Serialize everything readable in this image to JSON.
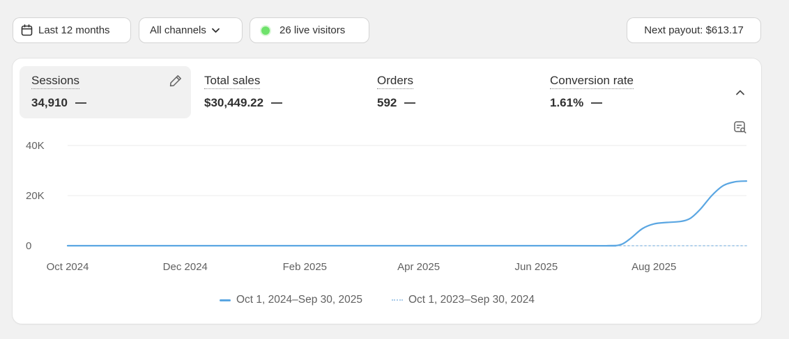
{
  "filters": {
    "date_range_label": "Last 12 months",
    "channels_label": "All channels",
    "live_visitors_label": "26 live visitors"
  },
  "payout": {
    "label": "Next payout: $613.17"
  },
  "metrics": [
    {
      "title": "Sessions",
      "value": "34,910"
    },
    {
      "title": "Total sales",
      "value": "$30,449.22"
    },
    {
      "title": "Orders",
      "value": "592"
    },
    {
      "title": "Conversion rate",
      "value": "1.61%"
    }
  ],
  "icons": {
    "date": "calendar-icon",
    "channels": "chevron-down-icon",
    "live": "live-status-dot-icon",
    "edit": "pencil-icon",
    "collapse": "chevron-up-icon",
    "chart_settings": "chart-search-icon"
  },
  "colors": {
    "current_series": "#5aa6e2",
    "previous_series": "#a8cbea",
    "live_dot": "#6ee26b"
  },
  "chart_data": {
    "type": "line",
    "ylim": [
      0,
      40000
    ],
    "y_ticks": [
      {
        "label": "0",
        "value": 0
      },
      {
        "label": "20K",
        "value": 20000
      },
      {
        "label": "40K",
        "value": 40000
      }
    ],
    "x_ticks": [
      "Oct 2024",
      "Dec 2024",
      "Feb 2025",
      "Apr 2025",
      "Jun 2025",
      "Aug 2025"
    ],
    "grid": true,
    "legend_position": "bottom-center",
    "series": [
      {
        "name": "Oct 1, 2024–Sep 30, 2025",
        "style": "solid",
        "points": [
          [
            "2024-10-01",
            0
          ],
          [
            "2025-06-15",
            0
          ],
          [
            "2025-07-08",
            0
          ],
          [
            "2025-07-15",
            500
          ],
          [
            "2025-07-20",
            3000
          ],
          [
            "2025-07-26",
            6800
          ],
          [
            "2025-08-01",
            8700
          ],
          [
            "2025-08-08",
            9300
          ],
          [
            "2025-08-15",
            9700
          ],
          [
            "2025-08-20",
            11000
          ],
          [
            "2025-08-25",
            14500
          ],
          [
            "2025-08-31",
            20000
          ],
          [
            "2025-09-06",
            24000
          ],
          [
            "2025-09-12",
            25500
          ],
          [
            "2025-09-18",
            25800
          ]
        ]
      },
      {
        "name": "Oct 1, 2023–Sep 30, 2024",
        "style": "dotted",
        "points": [
          [
            "2024-10-01",
            0
          ],
          [
            "2025-09-18",
            0
          ]
        ]
      }
    ]
  }
}
